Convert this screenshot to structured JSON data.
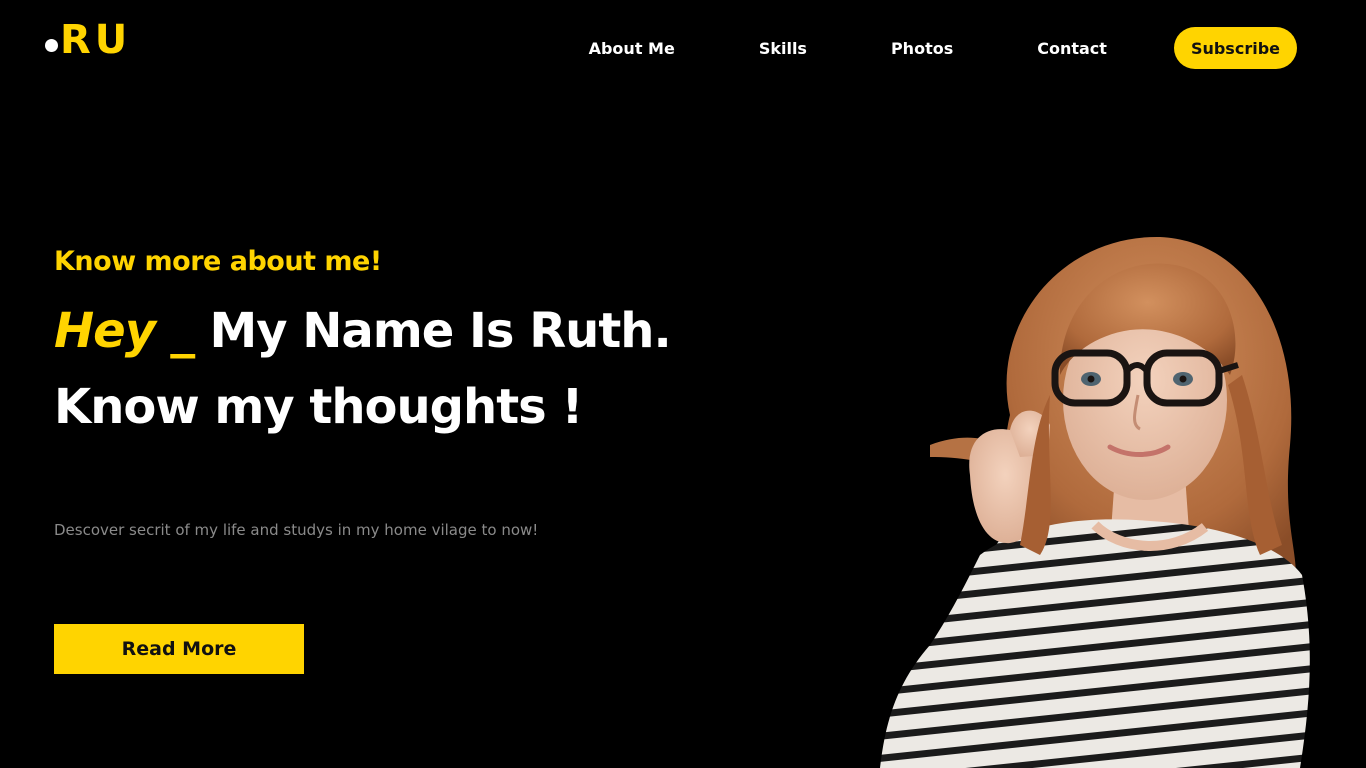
{
  "logo": {
    "text": "RU"
  },
  "nav": {
    "items": [
      {
        "label": "About Me"
      },
      {
        "label": "Skills"
      },
      {
        "label": "Photos"
      },
      {
        "label": "Contact"
      }
    ],
    "subscribe_label": "Subscribe"
  },
  "hero": {
    "eyebrow": "Know more about me!",
    "headline_accent": "Hey _",
    "headline_rest": " My Name Is Ruth.",
    "headline_line2": "Know my thoughts !",
    "description": "Descover secrit of my life and studys in my home vilage to now!",
    "cta_label": "Read More"
  },
  "colors": {
    "background": "#000000",
    "accent": "#ffd400",
    "text": "#ffffff",
    "muted": "#8a8a8a"
  }
}
